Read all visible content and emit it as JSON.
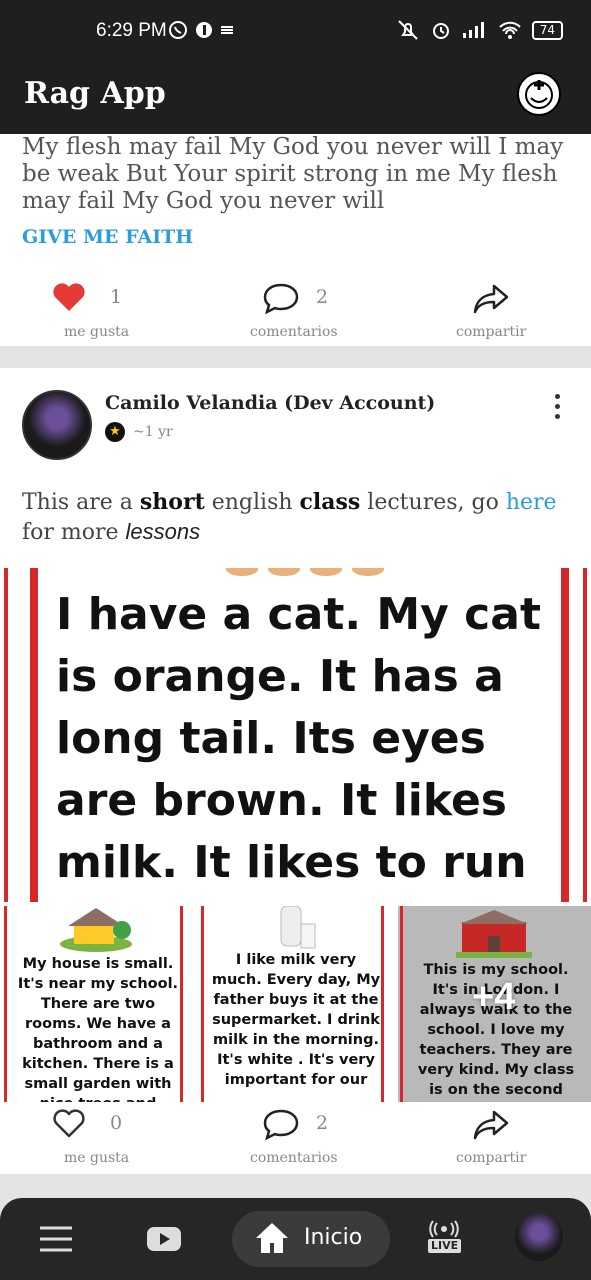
{
  "status": {
    "time": "6:29 PM",
    "battery": "74"
  },
  "appbar": {
    "title": "Rag App"
  },
  "post1": {
    "text": "My flesh may fail My God you never will I may be weak But Your spirit strong in me My flesh may fail My God you never will",
    "link": "GIVE ME FAITH",
    "likes": "1",
    "comments": "2",
    "like_label": "me gusta",
    "comment_label": "comentarios",
    "share_label": "compartir"
  },
  "post2": {
    "author": "Camilo Velandia (Dev Account)",
    "time": "~1 yr",
    "text_1": "This are a ",
    "text_bold1": "short",
    "text_2": " english ",
    "text_bold2": "class",
    "text_3": " lectures, go ",
    "text_link": "here",
    "text_4": " for more ",
    "text_italic": "lessons",
    "image_text": "I have a cat. My cat is orange. It has a long tail. Its eyes are brown. It likes milk. It likes to run",
    "thumb1": "My house is small. It's near my school. There are two rooms. We have a bathroom and a kitchen. There is a small garden with nice trees and",
    "thumb2": "I like milk very much. Every day, My father buys it at the supermarket. I drink milk in the morning. It's white . It's very important for our",
    "thumb3": "This is my school. It's in London. I always walk to the school. I love my teachers. They are very kind. My class is on the second floor. I play with my friends at break time.",
    "more": "+4",
    "likes": "0",
    "comments": "2",
    "like_label": "me gusta",
    "comment_label": "comentarios",
    "share_label": "compartir"
  },
  "nav": {
    "home_label": "Inicio",
    "live_label": "LIVE"
  }
}
